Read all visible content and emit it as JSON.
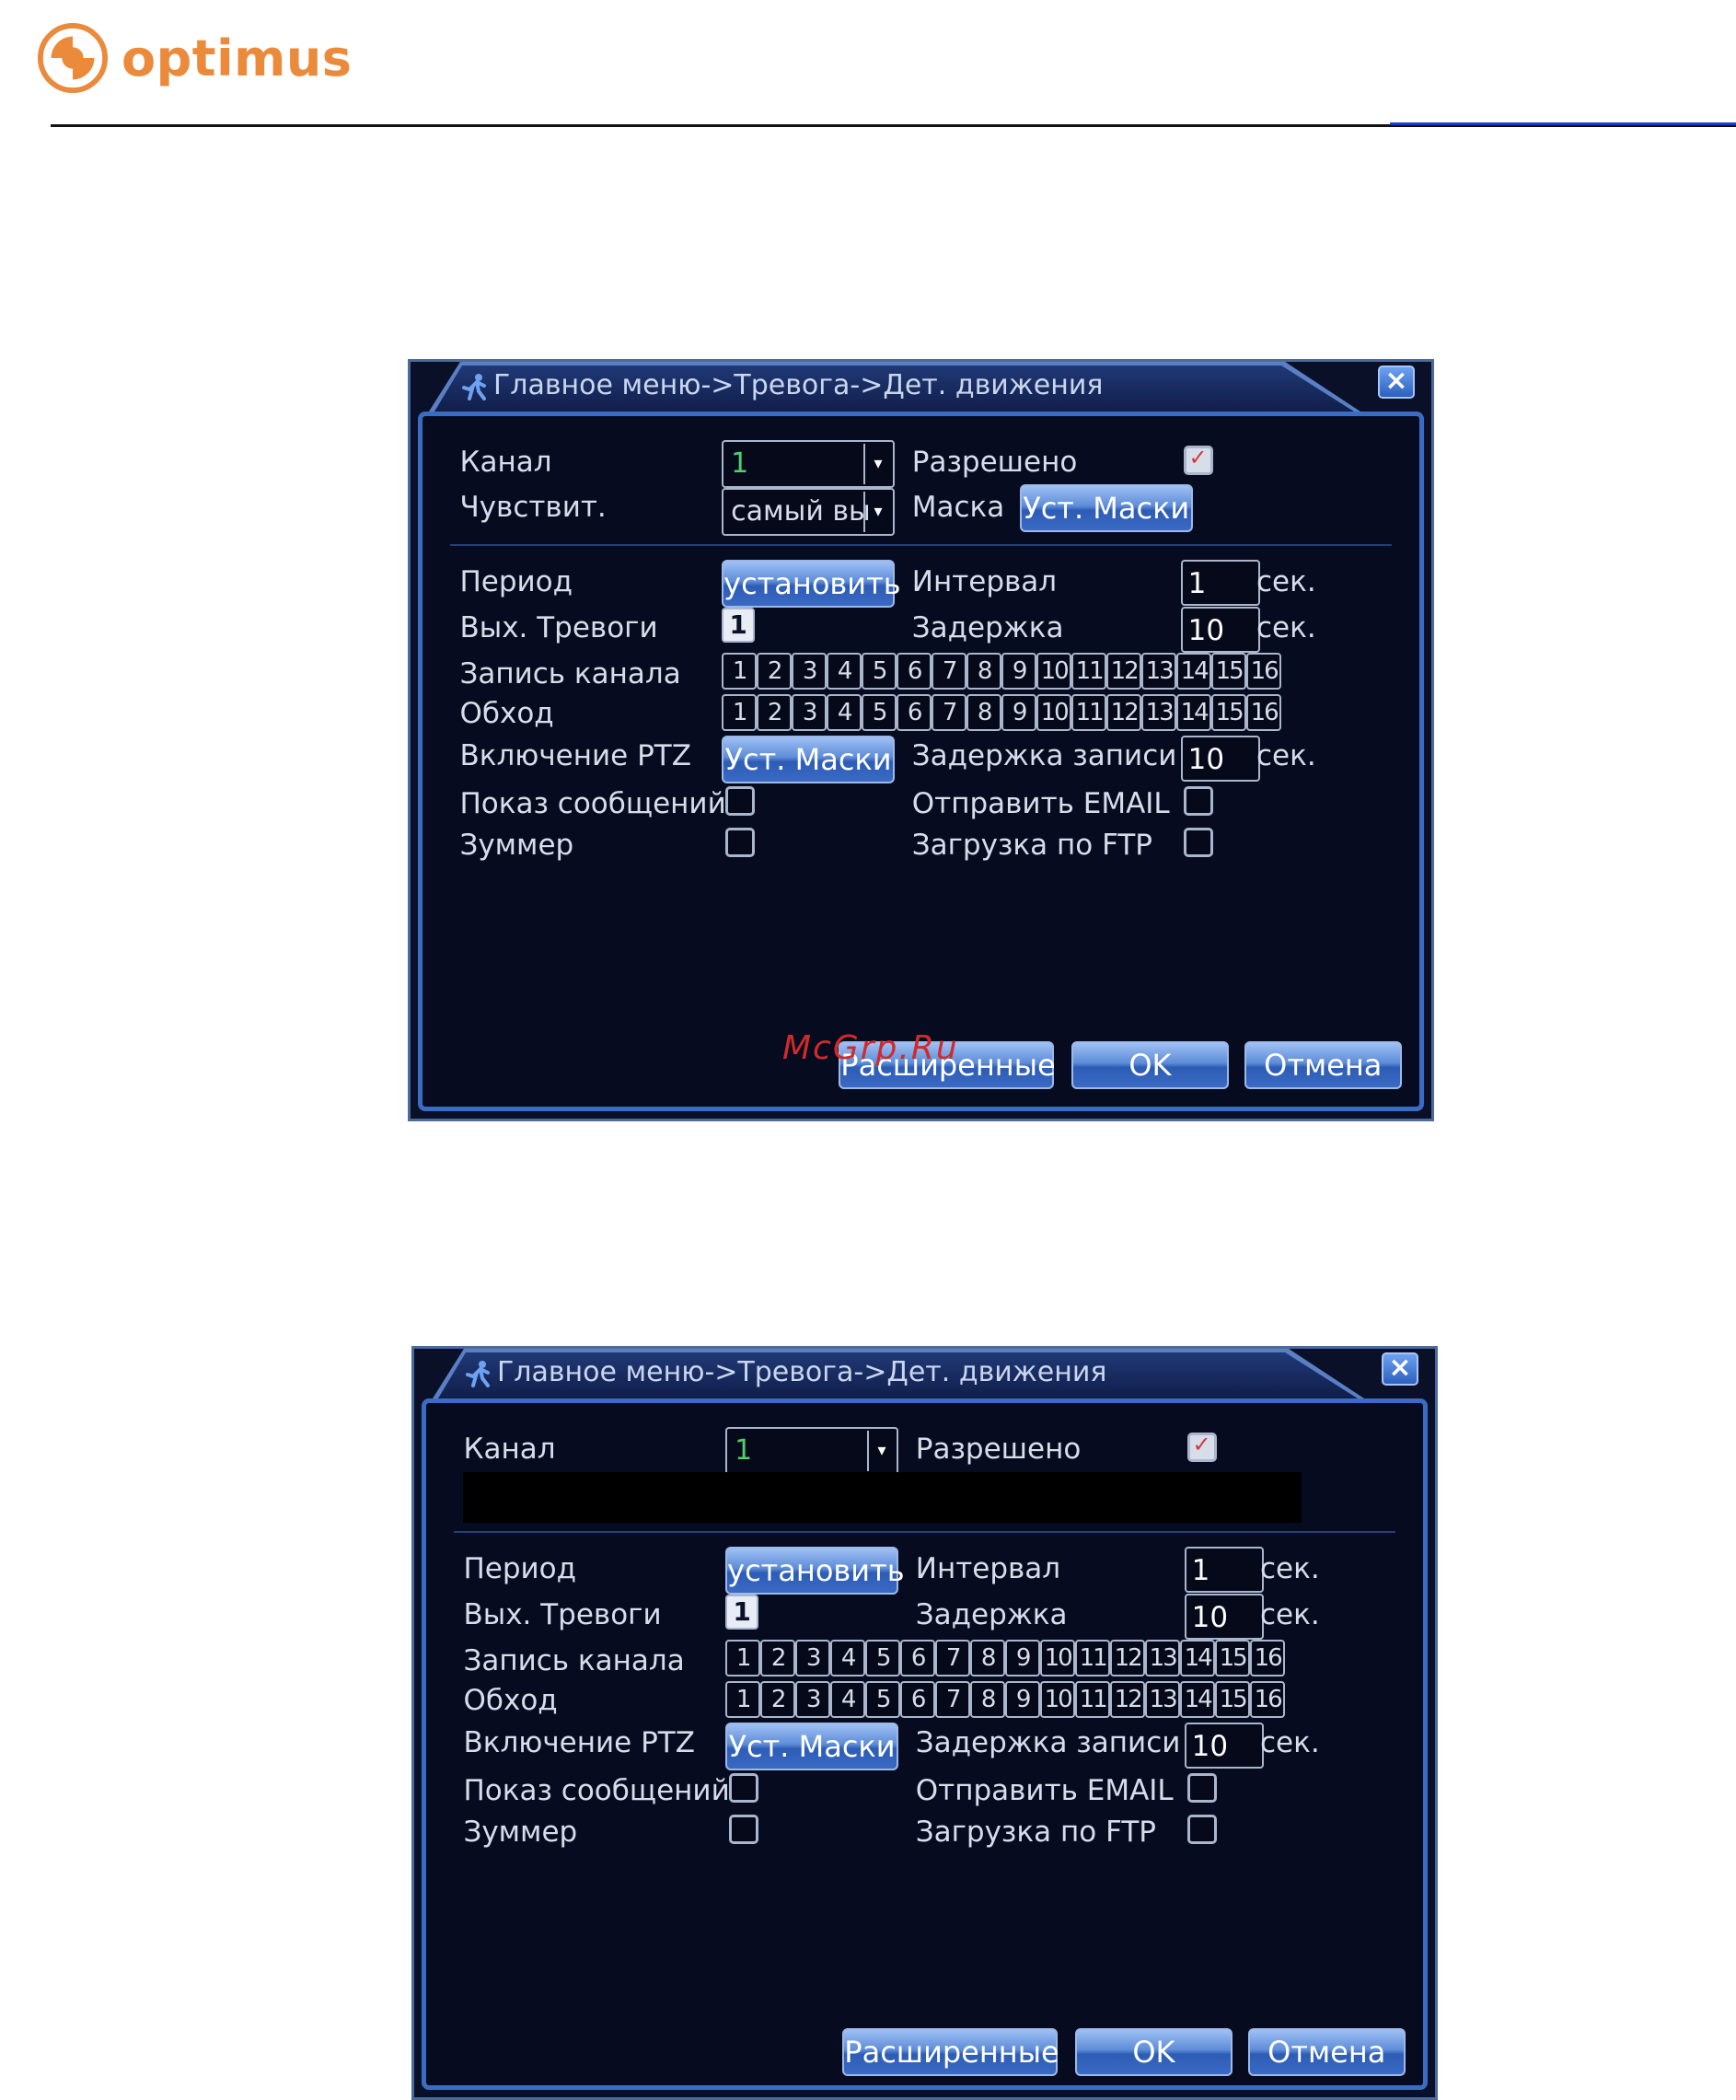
{
  "brand": {
    "name": "optimus",
    "color": "#ec8a3c"
  },
  "watermark": "McGrp.Ru",
  "dialogs": [
    {
      "title": "Главное меню->Тревога->Дет. движения",
      "channel_label": "Канал",
      "channel_value": "1",
      "enabled_label": "Разрешено",
      "enabled_checked": true,
      "sensitivity_label": "Чувствит.",
      "sensitivity_value": "самый вы",
      "mask_label": "Маска",
      "mask_button": "Уст. Маски",
      "period_label": "Период",
      "period_button": "установить",
      "interval_label": "Интервал",
      "interval_value": "1",
      "interval_unit": "сек.",
      "alarm_out_label": "Вых. Тревоги",
      "alarm_out_value": "1",
      "delay_label": "Задержка",
      "delay_value": "10",
      "delay_unit": "сек.",
      "record_channel_label": "Запись канала",
      "tour_label": "Обход",
      "channels": [
        "1",
        "2",
        "3",
        "4",
        "5",
        "6",
        "7",
        "8",
        "9",
        "10",
        "11",
        "12",
        "13",
        "14",
        "15",
        "16"
      ],
      "ptz_label": "Включение PTZ",
      "ptz_button": "Уст. Маски",
      "record_delay_label": "Задержка записи",
      "record_delay_value": "10",
      "record_delay_unit": "сек.",
      "show_msg_label": "Показ сообщений",
      "send_email_label": "Отправить EMAIL",
      "buzzer_label": "Зуммер",
      "ftp_label": "Загрузка по FTP",
      "advanced_button": "Расширенные",
      "ok_button": "OK",
      "cancel_button": "Отмена"
    },
    {
      "title": "Главное меню->Тревога->Дет. движения",
      "channel_label": "Канал",
      "channel_value": "1",
      "enabled_label": "Разрешено",
      "enabled_checked": true,
      "period_label": "Период",
      "period_button": "установить",
      "interval_label": "Интервал",
      "interval_value": "1",
      "interval_unit": "сек.",
      "alarm_out_label": "Вых. Тревоги",
      "alarm_out_value": "1",
      "delay_label": "Задержка",
      "delay_value": "10",
      "delay_unit": "сек.",
      "record_channel_label": "Запись канала",
      "tour_label": "Обход",
      "channels": [
        "1",
        "2",
        "3",
        "4",
        "5",
        "6",
        "7",
        "8",
        "9",
        "10",
        "11",
        "12",
        "13",
        "14",
        "15",
        "16"
      ],
      "ptz_label": "Включение PTZ",
      "ptz_button": "Уст. Маски",
      "record_delay_label": "Задержка записи",
      "record_delay_value": "10",
      "record_delay_unit": "сек.",
      "show_msg_label": "Показ сообщений",
      "send_email_label": "Отправить EMAIL",
      "buzzer_label": "Зуммер",
      "ftp_label": "Загрузка по FTP",
      "advanced_button": "Расширенные",
      "ok_button": "OK",
      "cancel_button": "Отмена"
    }
  ]
}
